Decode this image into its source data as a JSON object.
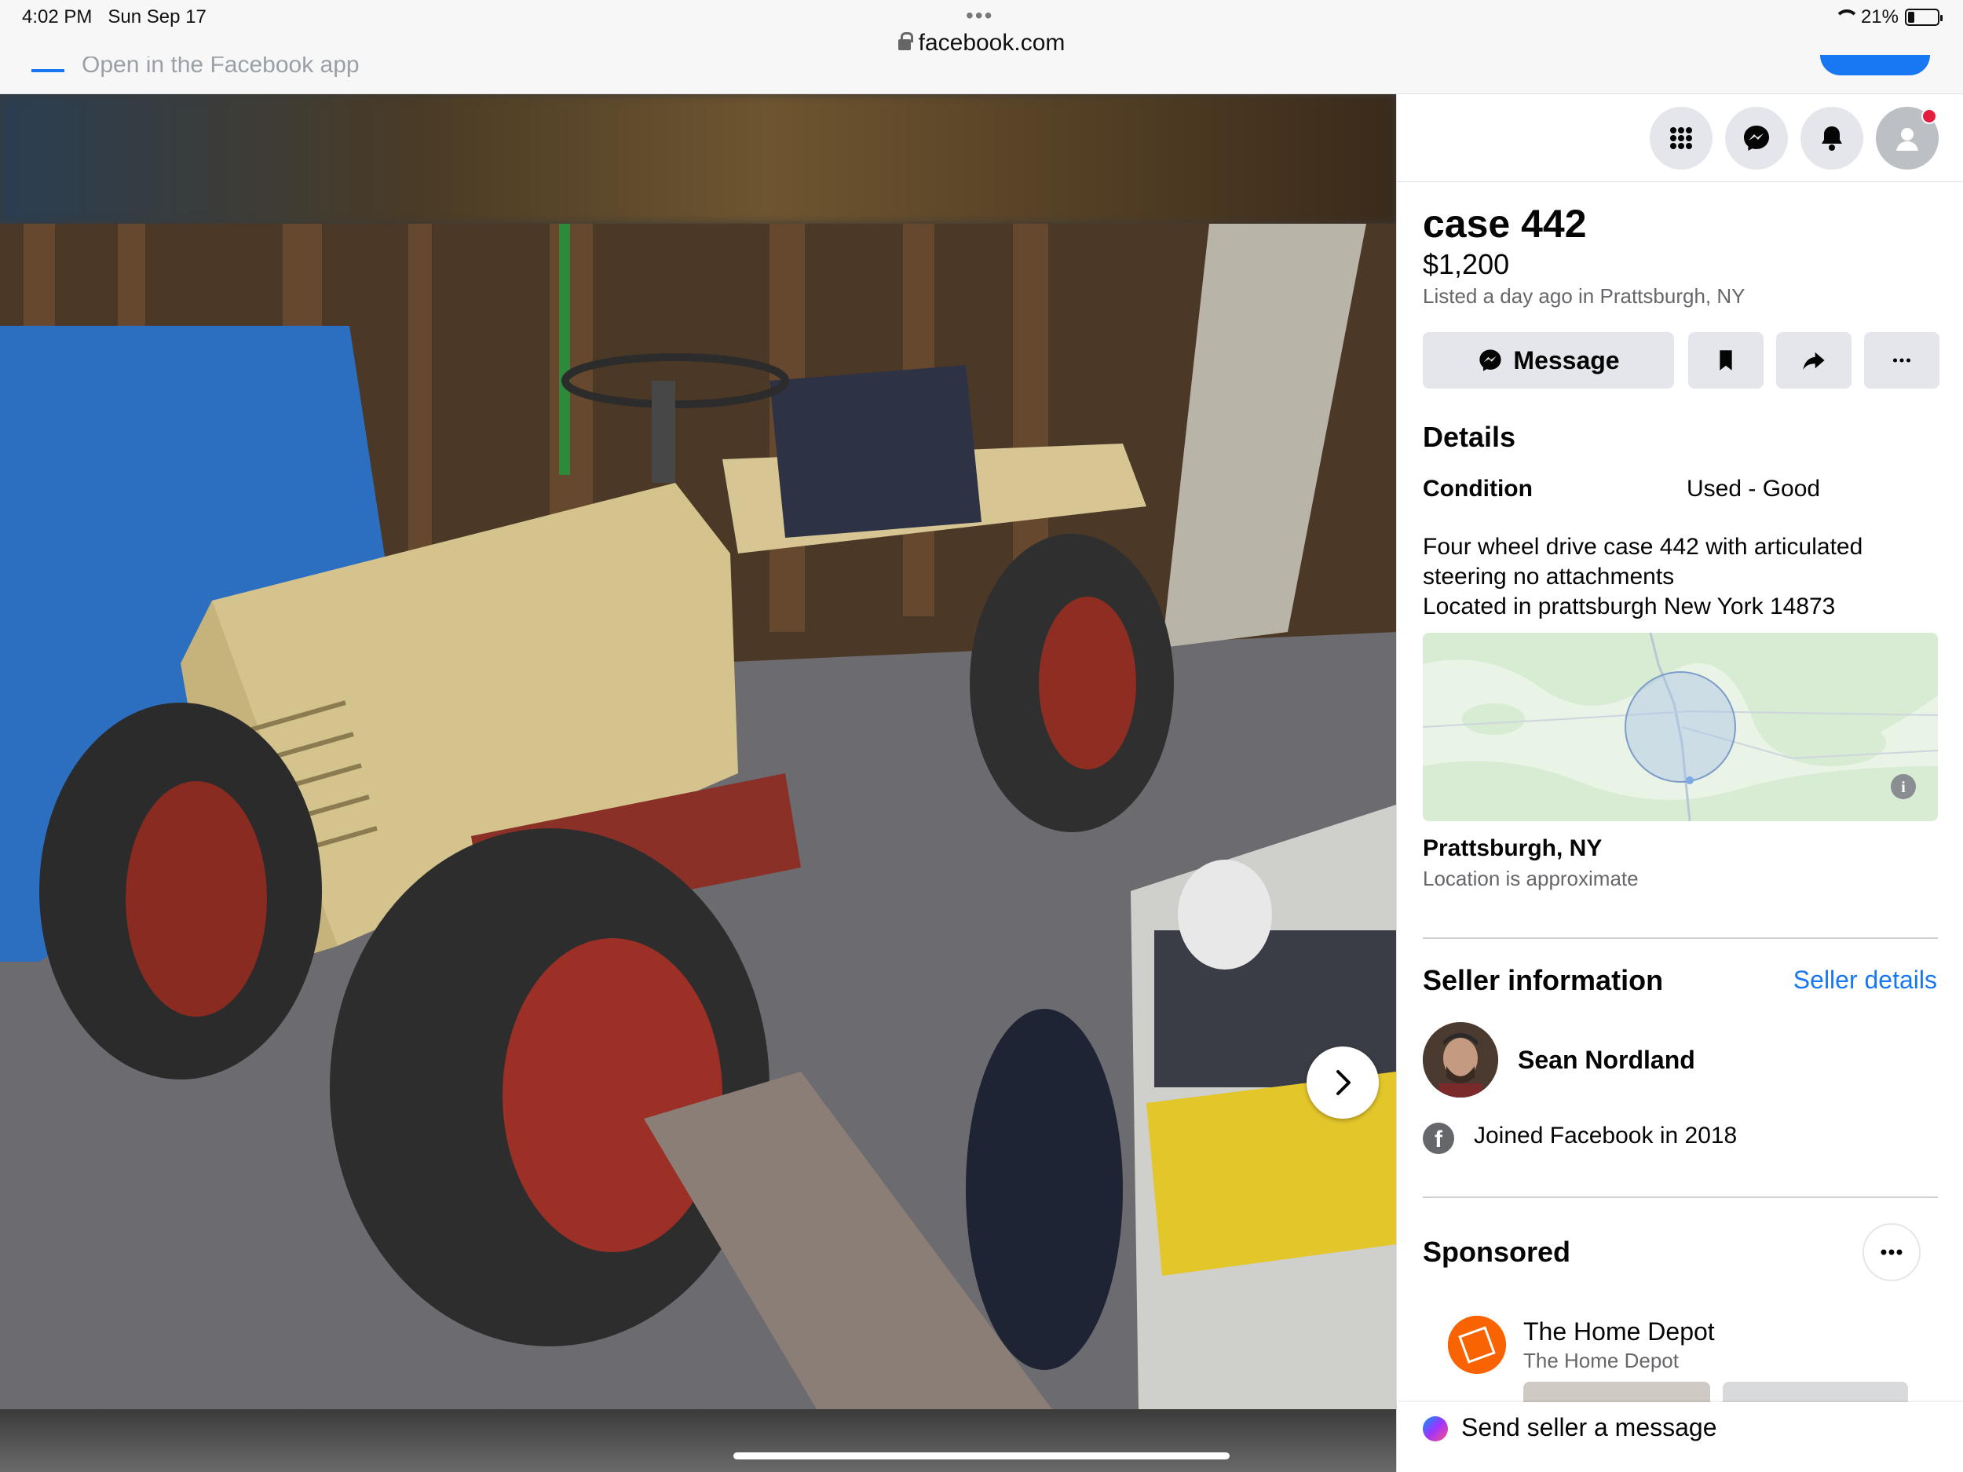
{
  "status_bar": {
    "time": "4:02 PM",
    "date": "Sun Sep 17",
    "battery": "21%",
    "url": "facebook.com"
  },
  "banner": {
    "open_app_text": "Open in the Facebook app"
  },
  "photo": {
    "alt": "case 442 tractor in barn",
    "next_icon": "chevron-right-icon"
  },
  "header_icons": [
    "menu-grid-icon",
    "messenger-icon",
    "notifications-icon",
    "profile-icon"
  ],
  "listing": {
    "title": "case 442",
    "price": "$1,200",
    "listed": "Listed a day ago in Prattsburgh, NY"
  },
  "actions": {
    "message_label": "Message"
  },
  "details": {
    "heading": "Details",
    "condition_label": "Condition",
    "condition_value": "Used - Good",
    "description_line1": "Four wheel drive case 442 with articulated",
    "description_line2": "steering no attachments",
    "description_line3": "Located in prattsburgh New York 14873"
  },
  "location": {
    "name": "Prattsburgh, NY",
    "note": "Location is approximate"
  },
  "seller": {
    "heading": "Seller information",
    "details_link": "Seller details",
    "name": "Sean Nordland",
    "joined": "Joined Facebook in 2018"
  },
  "sponsored": {
    "heading": "Sponsored",
    "advertiser": "The Home Depot",
    "advertiser_sub": "The Home Depot"
  },
  "send_bar": {
    "label": "Send seller a message"
  },
  "colors": {
    "accent": "#1877f2",
    "button_bg": "#e4e6eb",
    "secondary_text": "#65676b",
    "home_depot": "#f96302"
  }
}
